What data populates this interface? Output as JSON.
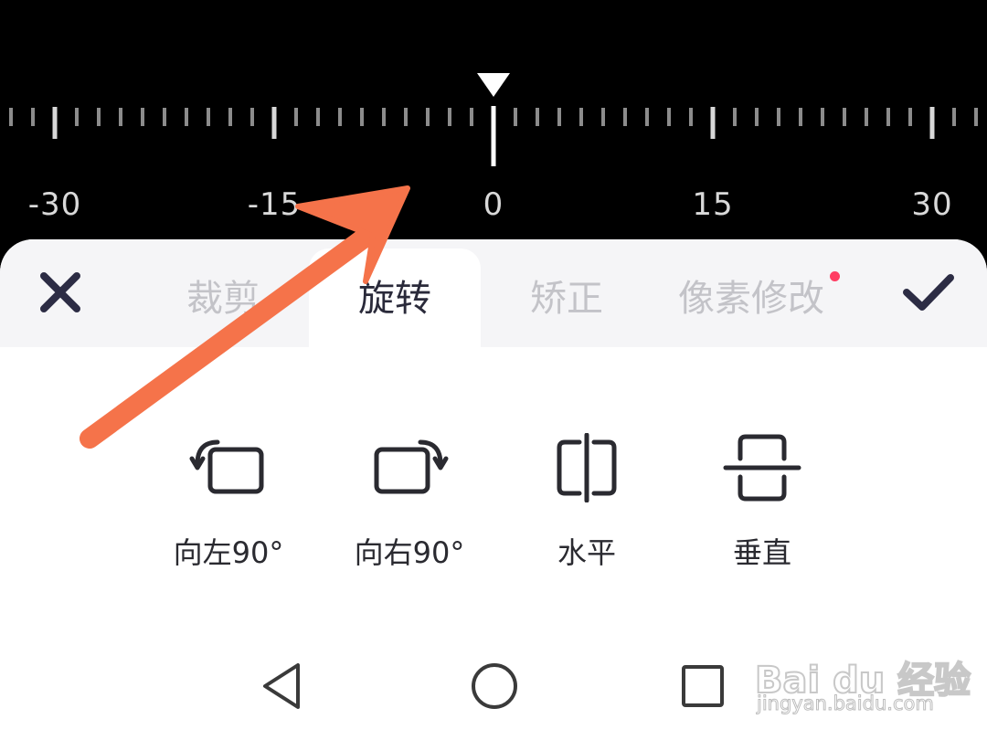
{
  "ruler": {
    "labels": [
      "-30",
      "-15",
      "0",
      "15",
      "30"
    ],
    "min": -30,
    "max": 30,
    "current_value": 0
  },
  "tabs": [
    {
      "label": "裁剪",
      "active": false
    },
    {
      "label": "旋转",
      "active": true
    },
    {
      "label": "矫正",
      "active": false
    },
    {
      "label": "像素修改",
      "active": false,
      "has_badge": true
    }
  ],
  "actions": {
    "close_icon": "close-icon",
    "confirm_icon": "check-icon"
  },
  "tools": [
    {
      "label": "向左90°",
      "icon": "rotate-left-icon"
    },
    {
      "label": "向右90°",
      "icon": "rotate-right-icon"
    },
    {
      "label": "水平",
      "icon": "flip-horizontal-icon"
    },
    {
      "label": "垂直",
      "icon": "flip-vertical-icon"
    }
  ],
  "navbar": {
    "back_icon": "back-triangle-icon",
    "home_icon": "home-circle-icon",
    "recents_icon": "recents-square-icon"
  },
  "watermark": {
    "brand": "Bai du 经验",
    "url": "jingyan.baidu.com"
  },
  "colors": {
    "ruler_bg": "#000000",
    "tab_inactive": "#c3c3c8",
    "tab_active": "#2a2a3a",
    "badge": "#ff3d63",
    "annotation_arrow": "#f5734a",
    "icon_dark": "#2c2c44"
  }
}
